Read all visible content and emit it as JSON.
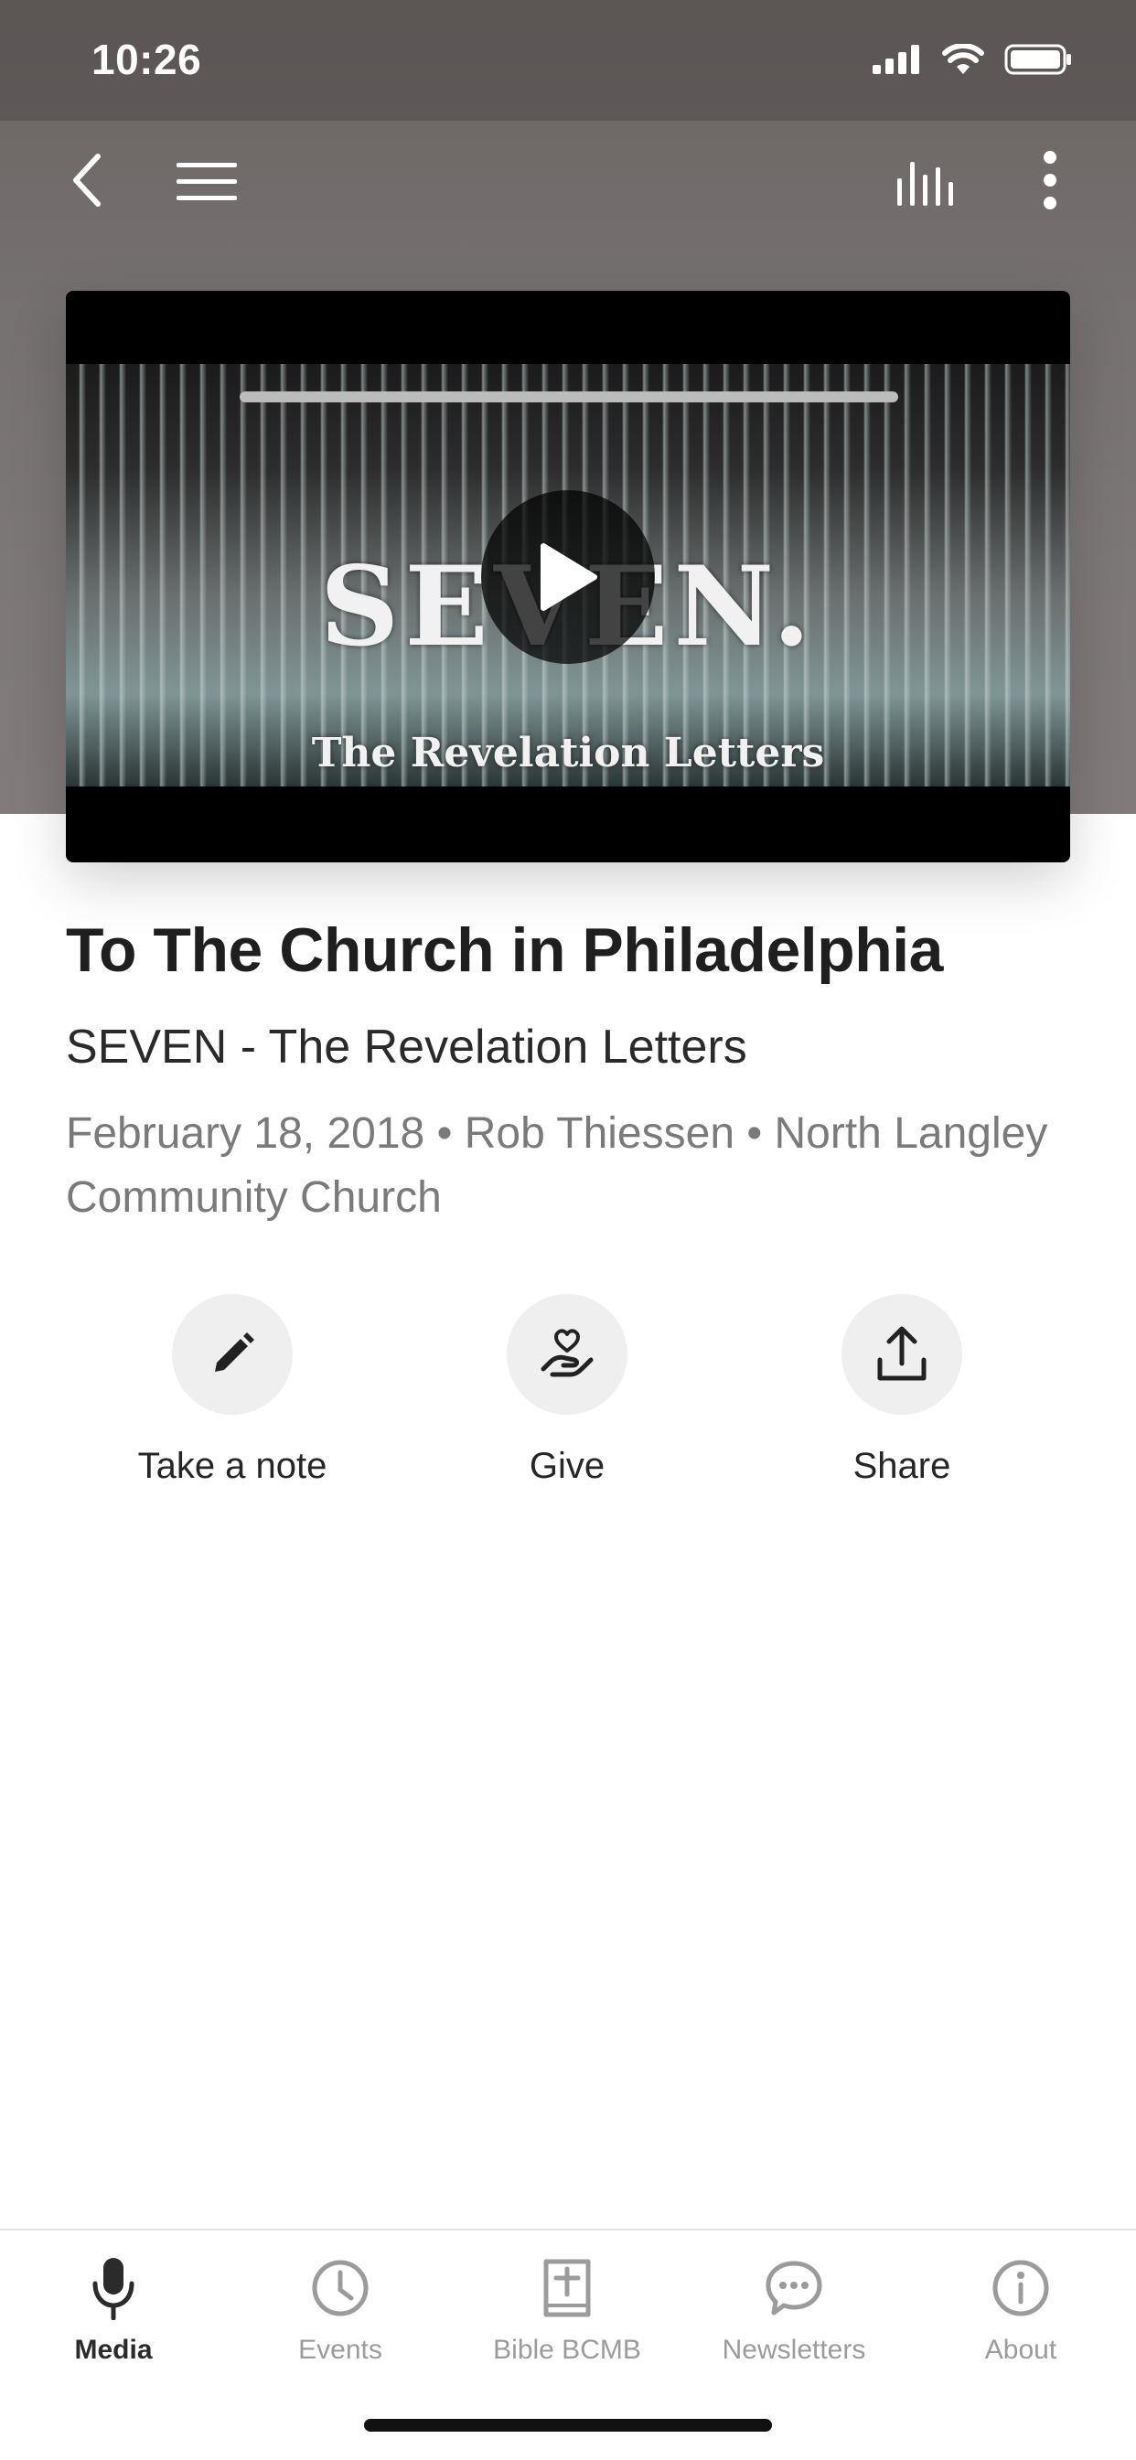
{
  "status_bar": {
    "time": "10:26"
  },
  "video": {
    "title_text": "SEVEN.",
    "subtitle_text": "The Revelation Letters"
  },
  "media": {
    "title": "To The Church in Philadelphia",
    "series": "SEVEN - The Revelation Letters",
    "meta": "February 18, 2018 • Rob Thiessen • North Langley Community Church"
  },
  "actions": [
    {
      "label": "Take a note",
      "icon": "pencil-icon"
    },
    {
      "label": "Give",
      "icon": "heart-hand-icon"
    },
    {
      "label": "Share",
      "icon": "share-icon"
    }
  ],
  "tabs": [
    {
      "label": "Media",
      "icon": "microphone-icon",
      "active": true
    },
    {
      "label": "Events",
      "icon": "clock-icon",
      "active": false
    },
    {
      "label": "Bible BCMB",
      "icon": "bible-icon",
      "active": false
    },
    {
      "label": "Newsletters",
      "icon": "chat-bubble-icon",
      "active": false
    },
    {
      "label": "About",
      "icon": "info-icon",
      "active": false
    }
  ],
  "colors": {
    "active_tab": "#2b2b2b",
    "inactive_tab": "#9b9b9b",
    "header_bg": "#757070"
  }
}
